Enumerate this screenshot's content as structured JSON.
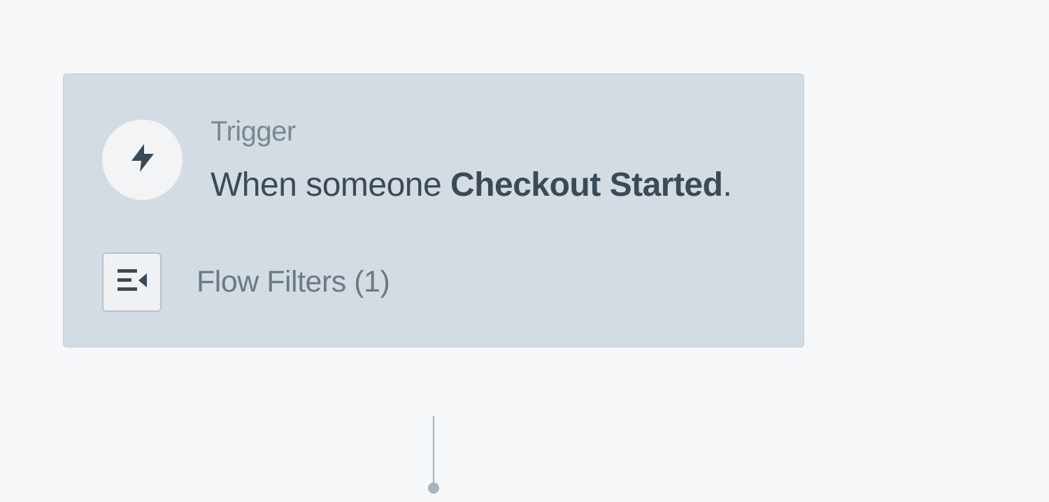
{
  "trigger": {
    "label": "Trigger",
    "description_prefix": "When someone ",
    "description_bold": "Checkout Started",
    "description_suffix": "."
  },
  "filters": {
    "label": "Flow Filters (1)",
    "count": 1
  }
}
